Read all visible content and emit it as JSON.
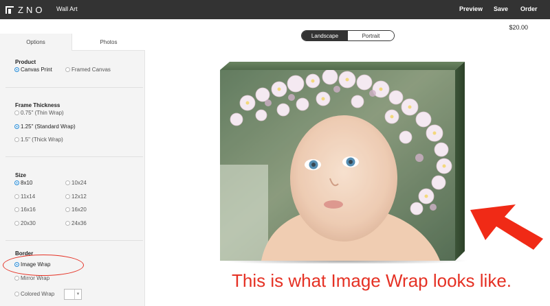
{
  "header": {
    "logo_text": "ZNO",
    "app_title": "Wall Art",
    "nav": [
      "Preview",
      "Save",
      "Order"
    ]
  },
  "sidebar": {
    "tabs": [
      "Options",
      "Photos"
    ],
    "active_tab": "Options",
    "product": {
      "title": "Product",
      "options": [
        "Canvas Print",
        "Framed Canvas"
      ],
      "selected": "Canvas Print"
    },
    "frame_thickness": {
      "title": "Frame Thickness",
      "options": [
        "0.75\" (Thin Wrap)",
        "1.25\" (Standard Wrap)",
        "1.5\" (Thick Wrap)"
      ],
      "selected": "1.25\" (Standard Wrap)"
    },
    "size": {
      "title": "Size",
      "options": [
        "8x10",
        "10x24",
        "11x14",
        "12x12",
        "16x16",
        "16x20",
        "20x30",
        "24x36"
      ],
      "selected": "8x10"
    },
    "border": {
      "title": "Border",
      "options": [
        "Image Wrap",
        "Mirror Wrap",
        "Colored Wrap"
      ],
      "selected": "Image Wrap",
      "color": "#ffffff"
    }
  },
  "main": {
    "orientation": [
      "Landscape",
      "Portrait"
    ],
    "selected_orientation": "Landscape",
    "price": "$20.00",
    "preview_image": "canvas-preview-baby-flower-crown"
  },
  "annotation": {
    "text": "This is what Image Wrap looks like.",
    "color": "#e53124"
  },
  "colors": {
    "topbar": "#333333",
    "accent": "#2b8ed8",
    "annotation": "#e53124"
  }
}
